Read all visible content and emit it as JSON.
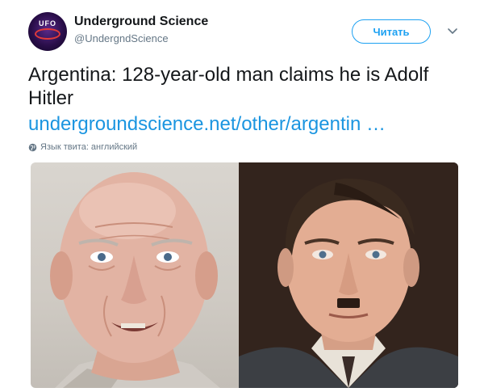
{
  "account": {
    "display_name": "Underground Science",
    "handle": "@UndergndScience",
    "avatar_text": "UFO"
  },
  "follow_button": {
    "label": "Читать"
  },
  "tweet": {
    "text": "Argentina: 128-year-old man claims he is Adolf Hitler",
    "link": "undergroundscience.net/other/argentin …"
  },
  "language_note": "Язык твита: английский",
  "icons": {
    "menu": "chevron-down-icon",
    "language": "globe-icon"
  },
  "colors": {
    "accent": "#1da1f2",
    "link": "#1b95e0",
    "secondary_text": "#657786"
  }
}
